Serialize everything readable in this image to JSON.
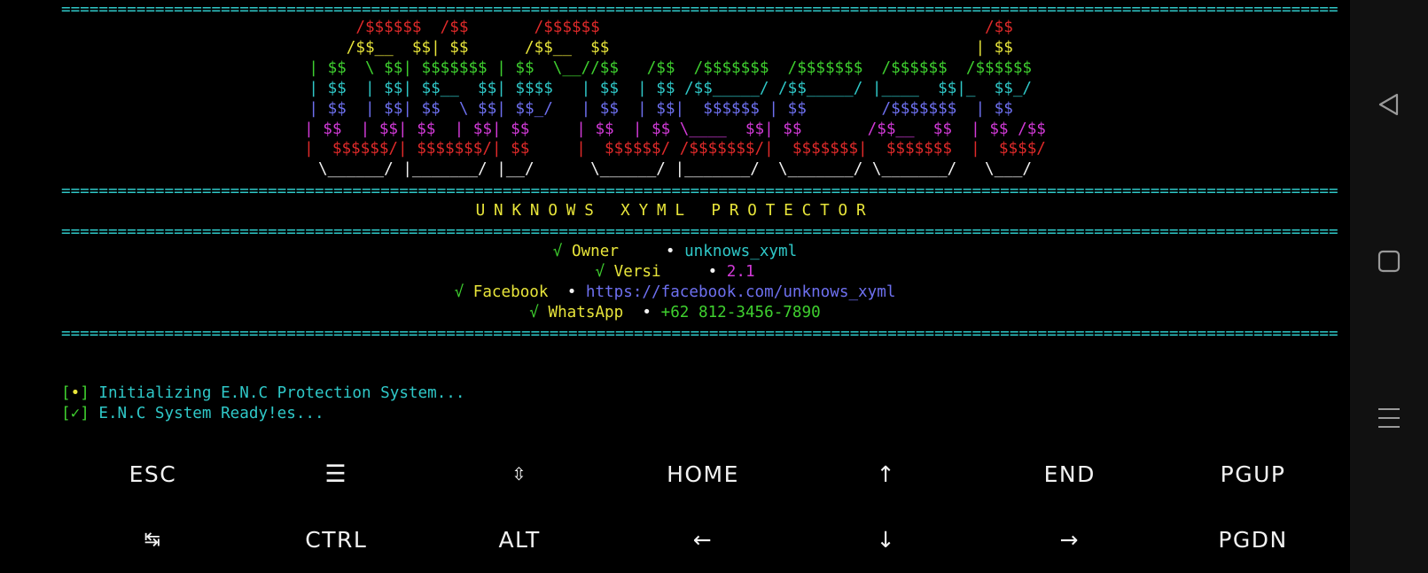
{
  "separator": "==================================================================================================================================================================",
  "banner": {
    "rows": [
      [
        {
          "t": "   /$$$$$$  /$$       /$$$$$$                                         /$$ ",
          "c": "red"
        }
      ],
      [
        {
          "t": "  /$$__  $$| $$      /$$__  $$                                       | $$ ",
          "c": "yellow"
        }
      ],
      [
        {
          "t": "| $$  \\ $$| $$$$$$$ | $$  \\__//$$   /$$  /$$$$$$$  /$$$$$$$  /$$$$$$  /$$$$$$ ",
          "c": "green"
        }
      ],
      [
        {
          "t": "| $$  | $$| $$__  $$| $$$$   | $$  | $$ /$$_____/ /$$_____/ |____  $$|_  $$_/ ",
          "c": "cyan"
        }
      ],
      [
        {
          "t": "| $$  | $$| $$  \\ $$| $$_/   | $$  | $$|  $$$$$$ | $$        /$$$$$$$  | $$   ",
          "c": "blue"
        }
      ],
      [
        {
          "t": "| $$  | $$| $$  | $$| $$     | $$  | $$ \\____  $$| $$       /$$__  $$  | $$ /$$",
          "c": "magenta"
        }
      ],
      [
        {
          "t": "|  $$$$$$/| $$$$$$$/| $$     |  $$$$$$/ /$$$$$$$/|  $$$$$$$|  $$$$$$$  |  $$$$/",
          "c": "red"
        }
      ],
      [
        {
          "t": " \\______/ |_______/ |__/      \\______/ |_______/  \\_______/ \\_______/   \\___/ ",
          "c": "white"
        }
      ]
    ]
  },
  "title": "UNKNOWS XYML PROTECTOR",
  "info": [
    {
      "check": "√",
      "label": "Owner    ",
      "bullet": "•",
      "value": "unknows_xyml",
      "value_color": "cyan"
    },
    {
      "check": "√",
      "label": "Versi    ",
      "bullet": "•",
      "value": "2.1",
      "value_color": "magenta"
    },
    {
      "check": "√",
      "label": "Facebook ",
      "bullet": "•",
      "value": "https://facebook.com/unknows_xyml",
      "value_color": "blue"
    },
    {
      "check": "√",
      "label": "WhatsApp ",
      "bullet": "•",
      "value": "+62 812-3456-7890",
      "value_color": "green"
    }
  ],
  "log": [
    {
      "open": "[",
      "mark": "•",
      "close": "]",
      "text": " Initializing E.N.C Protection System..."
    },
    {
      "open": "[",
      "mark": "✓",
      "close": "]",
      "text": " E.N.C System Ready!es..."
    }
  ],
  "keys": {
    "row1": [
      "ESC",
      "☰",
      "⇳",
      "HOME",
      "↑",
      "END",
      "PGUP"
    ],
    "row2": [
      "↹",
      "CTRL",
      "ALT",
      "←",
      "↓",
      "→",
      "PGDN"
    ]
  },
  "navbar": {
    "buttons": [
      {
        "name": "back-icon"
      },
      {
        "name": "home-square-icon"
      },
      {
        "name": "recents-menu-icon"
      }
    ]
  },
  "colors": {
    "red": "#e02a2a",
    "yellow": "#e8e53a",
    "green": "#3fd02f",
    "cyan": "#2fc8c8",
    "blue": "#6e70f0",
    "magenta": "#d23ad8",
    "white": "#f2f2f2",
    "background": "#000000"
  }
}
